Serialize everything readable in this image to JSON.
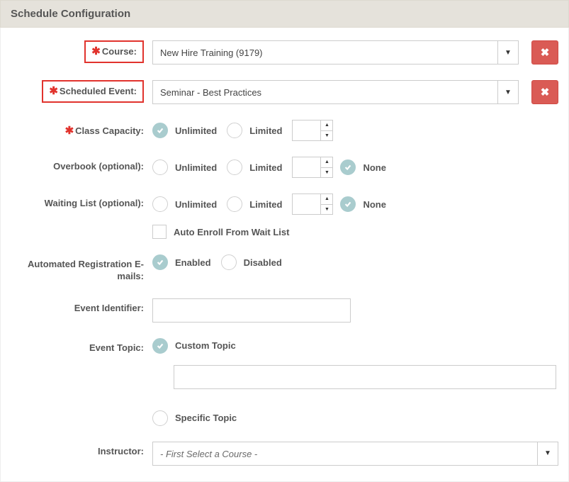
{
  "header": {
    "title": "Schedule Configuration"
  },
  "labels": {
    "course": "Course:",
    "scheduled_event": "Scheduled Event:",
    "class_capacity": "Class Capacity:",
    "overbook": "Overbook (optional):",
    "waiting_list": "Waiting List (optional):",
    "auto_emails": "Automated Registration E-mails:",
    "event_identifier": "Event Identifier:",
    "event_topic": "Event Topic:",
    "instructor": "Instructor:"
  },
  "values": {
    "course": "New Hire Training (9179)",
    "scheduled_event": "Seminar - Best Practices",
    "instructor": "- First Select a Course -",
    "event_identifier": "",
    "custom_topic_text": ""
  },
  "options": {
    "unlimited": "Unlimited",
    "limited": "Limited",
    "none": "None",
    "enabled": "Enabled",
    "disabled": "Disabled",
    "auto_enroll": "Auto Enroll From Wait List",
    "custom_topic": "Custom Topic",
    "specific_topic": "Specific Topic"
  }
}
